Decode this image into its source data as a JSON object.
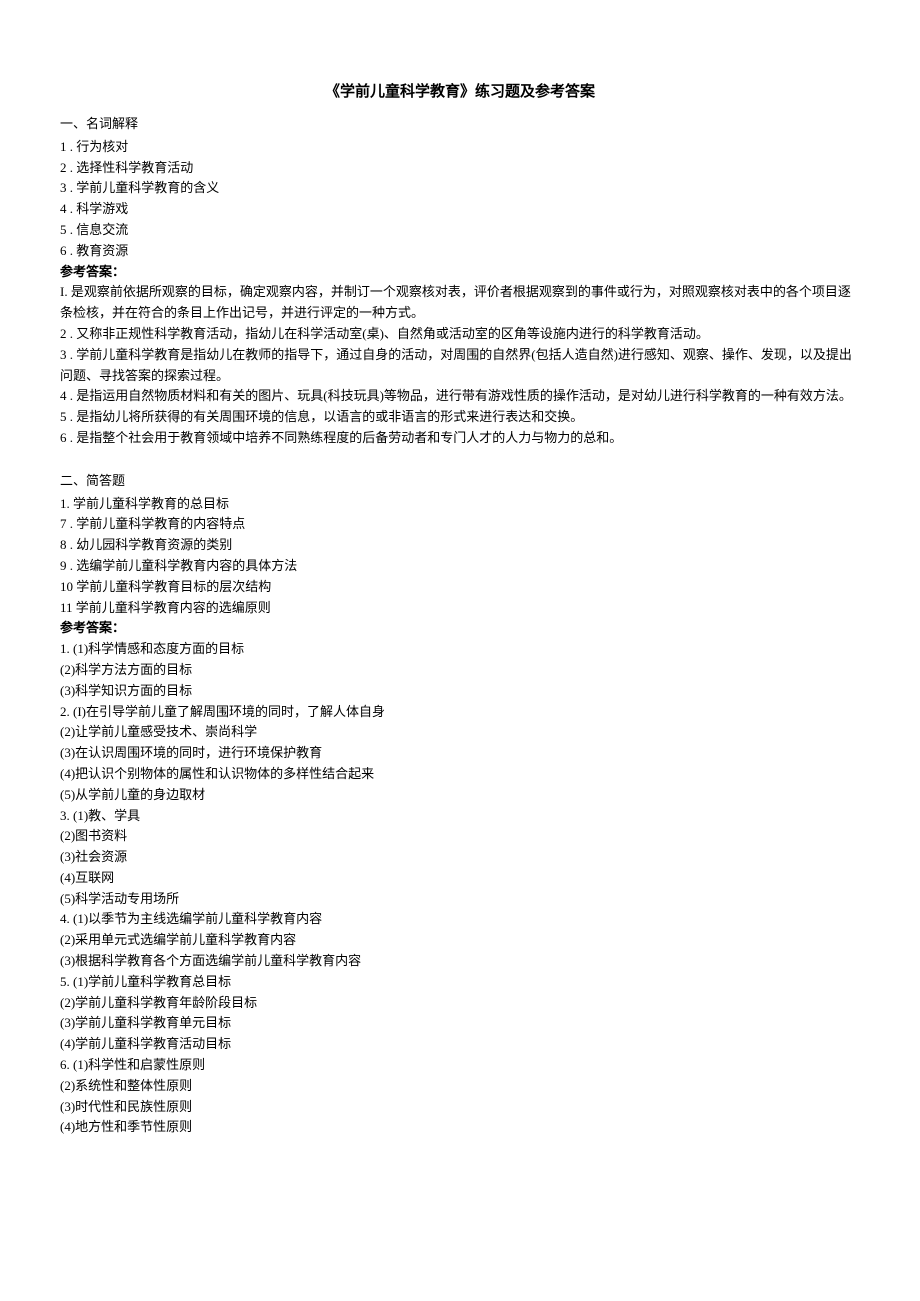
{
  "title": "《学前儿童科学教育》练习题及参考答案",
  "section1": {
    "heading": "一、名词解释",
    "items": [
      "1 . 行为核对",
      "2 . 选择性科学教育活动",
      "3 . 学前儿童科学教育的含义",
      "4 . 科学游戏",
      "5 . 信息交流",
      "6 . 教育资源"
    ],
    "answer_heading": "参考答案：",
    "answers": [
      "I. 是观察前依据所观察的目标，确定观察内容，并制订一个观察核对表，评价者根据观察到的事件或行为，对照观察核对表中的各个项目逐条检核，并在符合的条目上作出记号，并进行评定的一种方式。",
      "2 . 又称非正规性科学教育活动，指幼儿在科学活动室(桌)、自然角或活动室的区角等设施内进行的科学教育活动。",
      "3 . 学前儿童科学教育是指幼儿在教师的指导下，通过自身的活动，对周围的自然界(包括人造自然)进行感知、观察、操作、发现，以及提出问题、寻找答案的探索过程。",
      "4 . 是指运用自然物质材料和有关的图片、玩具(科技玩具)等物品，进行带有游戏性质的操作活动，是对幼儿进行科学教育的一种有效方法。",
      "5 . 是指幼儿将所获得的有关周围环境的信息，以语言的或非语言的形式来进行表达和交换。",
      "6 . 是指整个社会用于教育领域中培养不同熟练程度的后备劳动者和专门人才的人力与物力的总和。"
    ]
  },
  "section2": {
    "heading": "二、简答题",
    "items": [
      "1. 学前儿童科学教育的总目标",
      "7 . 学前儿童科学教育的内容特点",
      "8 . 幼儿园科学教育资源的类别",
      "9 . 选编学前儿童科学教育内容的具体方法",
      "10 学前儿童科学教育目标的层次结构",
      "11 学前儿童科学教育内容的选编原则"
    ],
    "answer_heading": "参考答案：",
    "answers": [
      "1.  (1)科学情感和态度方面的目标",
      "(2)科学方法方面的目标",
      "(3)科学知识方面的目标",
      "2.  (I)在引导学前儿童了解周围环境的同时，了解人体自身",
      "(2)让学前儿童感受技术、崇尚科学",
      "(3)在认识周围环境的同时，进行环境保护教育",
      "(4)把认识个别物体的属性和认识物体的多样性结合起来",
      "(5)从学前儿童的身边取材",
      "3.  (1)教、学具",
      "(2)图书资料",
      "(3)社会资源",
      "(4)互联网",
      "(5)科学活动专用场所",
      "4.  (1)以季节为主线选编学前儿童科学教育内容",
      "(2)采用单元式选编学前儿童科学教育内容",
      "(3)根据科学教育各个方面选编学前儿童科学教育内容",
      "5.  (1)学前儿童科学教育总目标",
      "(2)学前儿童科学教育年龄阶段目标",
      "(3)学前儿童科学教育单元目标",
      "(4)学前儿童科学教育活动目标",
      "6.  (1)科学性和启蒙性原则",
      "(2)系统性和整体性原则",
      "(3)时代性和民族性原则",
      "(4)地方性和季节性原则"
    ]
  }
}
